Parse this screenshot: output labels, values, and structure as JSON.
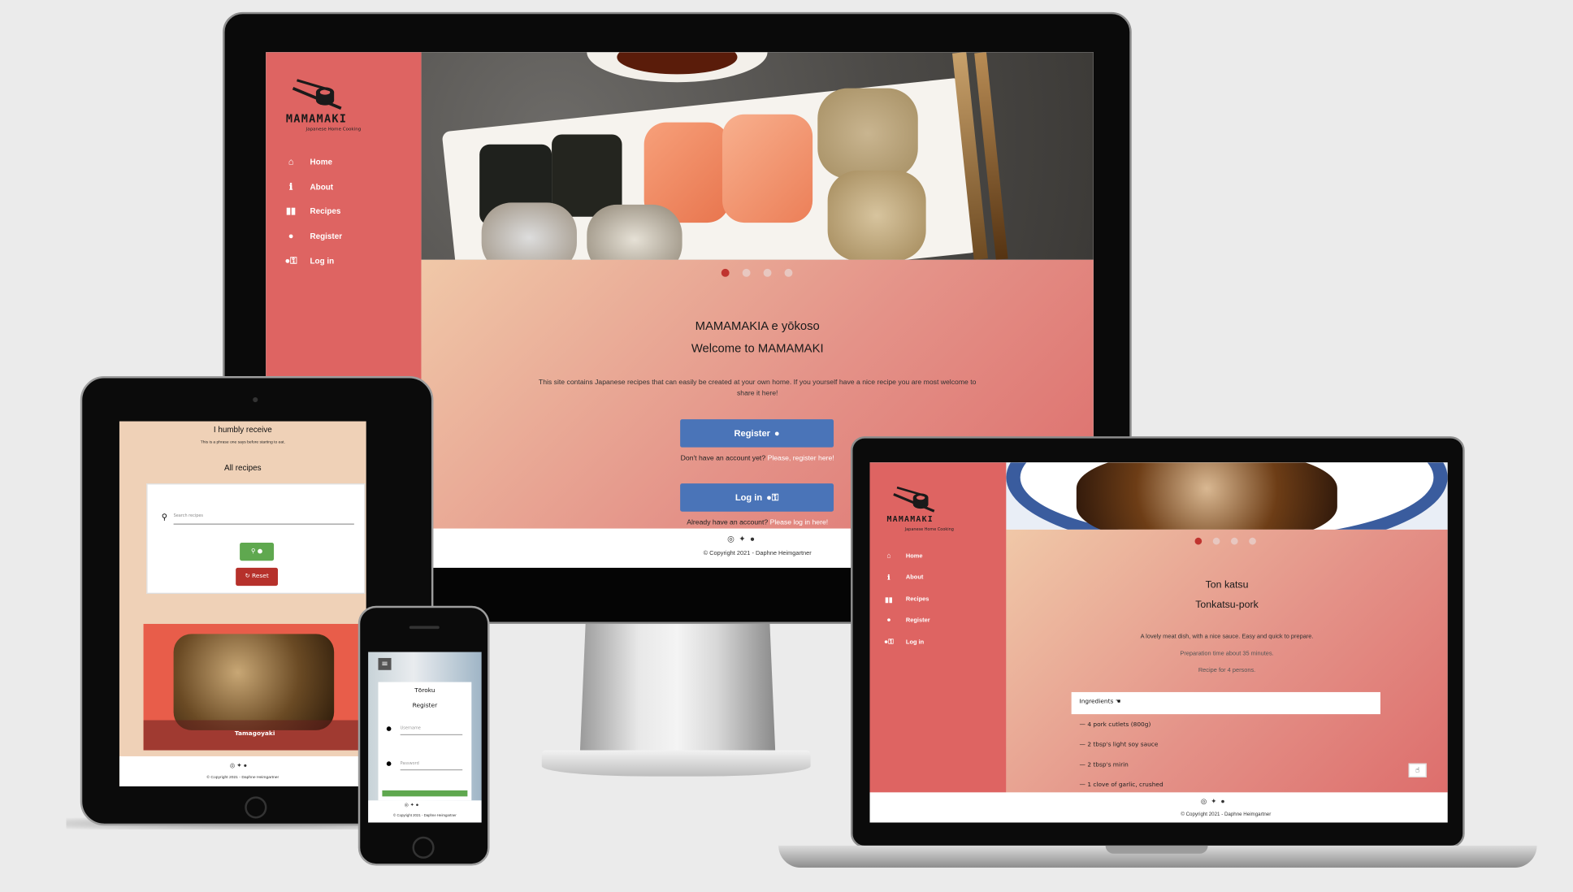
{
  "site": {
    "brand": "MAMAMAKI",
    "tagline": "Japanese Home Cooking",
    "nav": [
      "Home",
      "About",
      "Recipes",
      "Register",
      "Log in"
    ],
    "copyright": "© Copyright 2021 - Daphne Heimgartner"
  },
  "desktop": {
    "heading_jp": "MAMAMAKIA e yōkoso",
    "heading_en": "Welcome to MAMAMAKI",
    "intro": "This site contains Japanese recipes that can easily be created at your own home. If you yourself have a nice recipe you are most welcome to share it here!",
    "register_btn": "Register",
    "no_account_text": "Don't have an account yet?",
    "no_account_link": "Please, register here!",
    "login_btn": "Log in",
    "has_account_text": "Already have an account?",
    "has_account_link": "Please log in here!"
  },
  "laptop": {
    "heading_jp": "Ton katsu",
    "heading_en": "Tonkatsu-pork",
    "desc": "A lovely meat dish, with a nice sauce. Easy and quick to prepare.",
    "prep_time": "Preparation time about 35 minutes.",
    "servings": "Recipe for 4 persons.",
    "ingredients_label": "Ingredients",
    "ingredients": [
      "4 pork cutlets (800g)",
      "2 tbsp's light soy sauce",
      "2 tbsp's mirin",
      "1 clove of garlic, crushed"
    ]
  },
  "tablet": {
    "heading": "I humbly receive",
    "subheading": "This is a phrase one says before starting to eat.",
    "all_recipes": "All recipes",
    "search_placeholder": "Search recipes",
    "reset_btn": "Reset",
    "recipe_title": "Tamagoyaki"
  },
  "phone": {
    "heading_jp": "Tōroku",
    "heading_en": "Register",
    "username_placeholder": "Username",
    "password_placeholder": "Password"
  },
  "colors": {
    "sidebar": "#de6462",
    "button_blue": "#4a74b8",
    "button_green": "#5fa84f",
    "button_red": "#b6312b",
    "beige": "#efd1b7"
  }
}
